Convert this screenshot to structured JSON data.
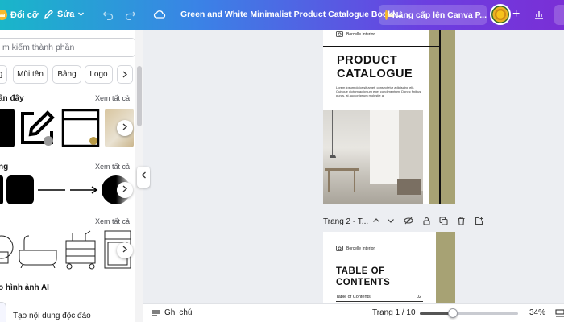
{
  "topbar": {
    "resize_label": "Đổi cỡ",
    "edit_label": "Sửa",
    "doc_title": "Green and White Minimalist Product Catalogue Bookl...",
    "upgrade_label": "Nâng cấp lên Canva P...",
    "plus": "+"
  },
  "panel": {
    "search_placeholder": "m kiếm thành phần",
    "chips": [
      "g",
      "Mũi tên",
      "Bảng",
      "Logo"
    ],
    "recent_title": "ần đây",
    "recent_see_all": "Xem tất cả",
    "shapes_title": "ng",
    "shapes_see_all": "Xem tất cả",
    "graphics_see_all": "Xem tất cả",
    "ai_title": "o hình ảnh AI",
    "ai_item": "Tạo nội dung độc đáo"
  },
  "page1": {
    "brand": "Borcelle Interior",
    "title_line1": "PRODUCT",
    "title_line2": "CATALOGUE",
    "lorem": "Lorem ipsum dolor sit amet, consectetur adipiscing elit. Quisque dictum ac ipsum eget condimentum. Donec finibus purus, at auctor ipsum molestie a."
  },
  "page2": {
    "brand": "Borcelle Interior",
    "title_line1": "TABLE OF",
    "title_line2": "CONTENTS",
    "toc_label": "Table of Contents",
    "toc_page": "02"
  },
  "page_toolbar": {
    "label": "Trang 2 - T..."
  },
  "bottombar": {
    "notes_label": "Ghi chú",
    "page_indicator": "Trang 1 / 10",
    "zoom": "34%",
    "zoom_fraction": 0.34
  },
  "colors": {
    "olive": "#a7a274",
    "topbar_start": "#19b6c9",
    "topbar_end": "#7a2fd6"
  }
}
